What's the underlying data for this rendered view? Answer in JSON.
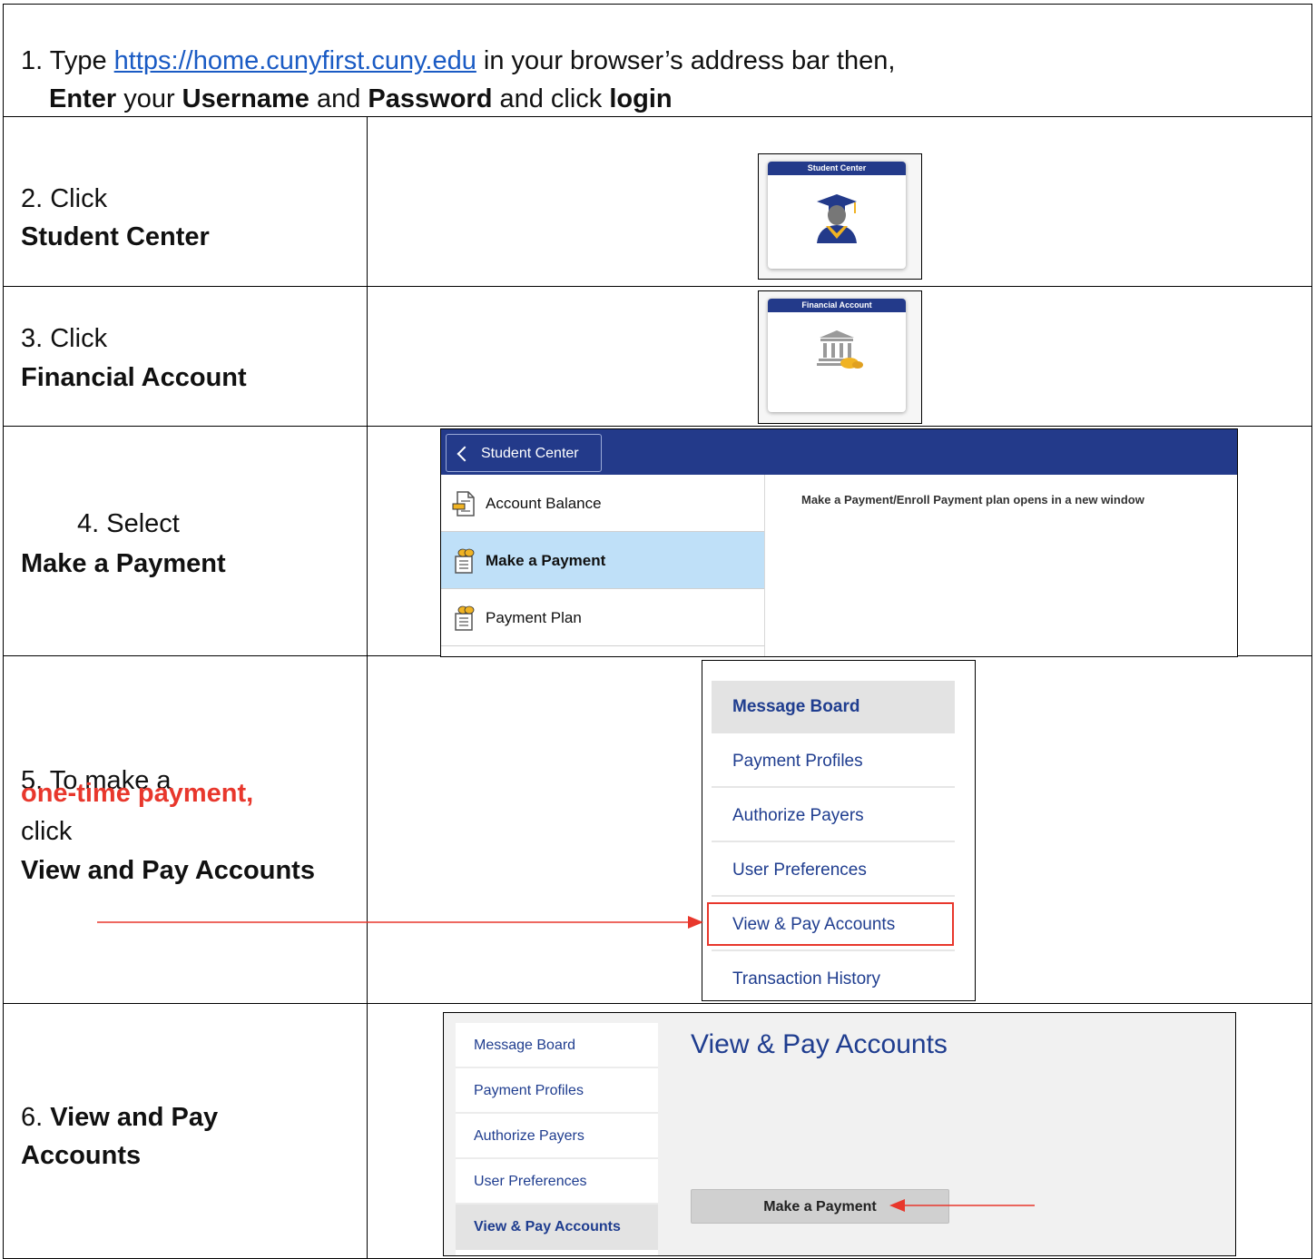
{
  "step1": {
    "line1_prefix": "1. Type ",
    "url": "https://home.cunyfirst.cuny.edu",
    "line1_suffix": " in your browser’s address bar then,",
    "enter": "Enter",
    "your": " your ",
    "username": "Username",
    "and1": " and ",
    "password": "Password",
    "and_click": " and click ",
    "login": "login"
  },
  "step2": {
    "number_text": "2. Click",
    "action": "Student Center",
    "tile_title": "Student Center"
  },
  "step3": {
    "number_text": "3. Click",
    "action": "Financial Account",
    "tile_title": "Financial Account"
  },
  "step4": {
    "number_text": "4. Select",
    "action": "Make a Payment",
    "back_button": "Student Center",
    "menu": [
      "Account Balance",
      "Make a Payment",
      "Payment Plan"
    ],
    "active_index": 1,
    "message": "Make a Payment/Enroll Payment plan opens in a new window"
  },
  "step5": {
    "line1": "5. To make a",
    "highlight": "one-time payment",
    "comma": ",",
    "line3": "click",
    "action": "View and Pay Accounts",
    "menu": [
      "Message Board",
      "Payment Profiles",
      "Authorize Payers",
      "User Preferences",
      "View & Pay Accounts",
      "Transaction History"
    ]
  },
  "step6": {
    "number": "6. ",
    "action_line1": "View and Pay",
    "action_line2": "Accounts",
    "menu": [
      "Message Board",
      "Payment Profiles",
      "Authorize Payers",
      "User Preferences",
      "View & Pay Accounts"
    ],
    "page_title": "View & Pay Accounts",
    "button": "Make a Payment"
  },
  "colors": {
    "navy": "#233a8a",
    "link_text": "#1f3d8f",
    "accent_red": "#e8372c",
    "active_blue": "#bfe0f8"
  }
}
